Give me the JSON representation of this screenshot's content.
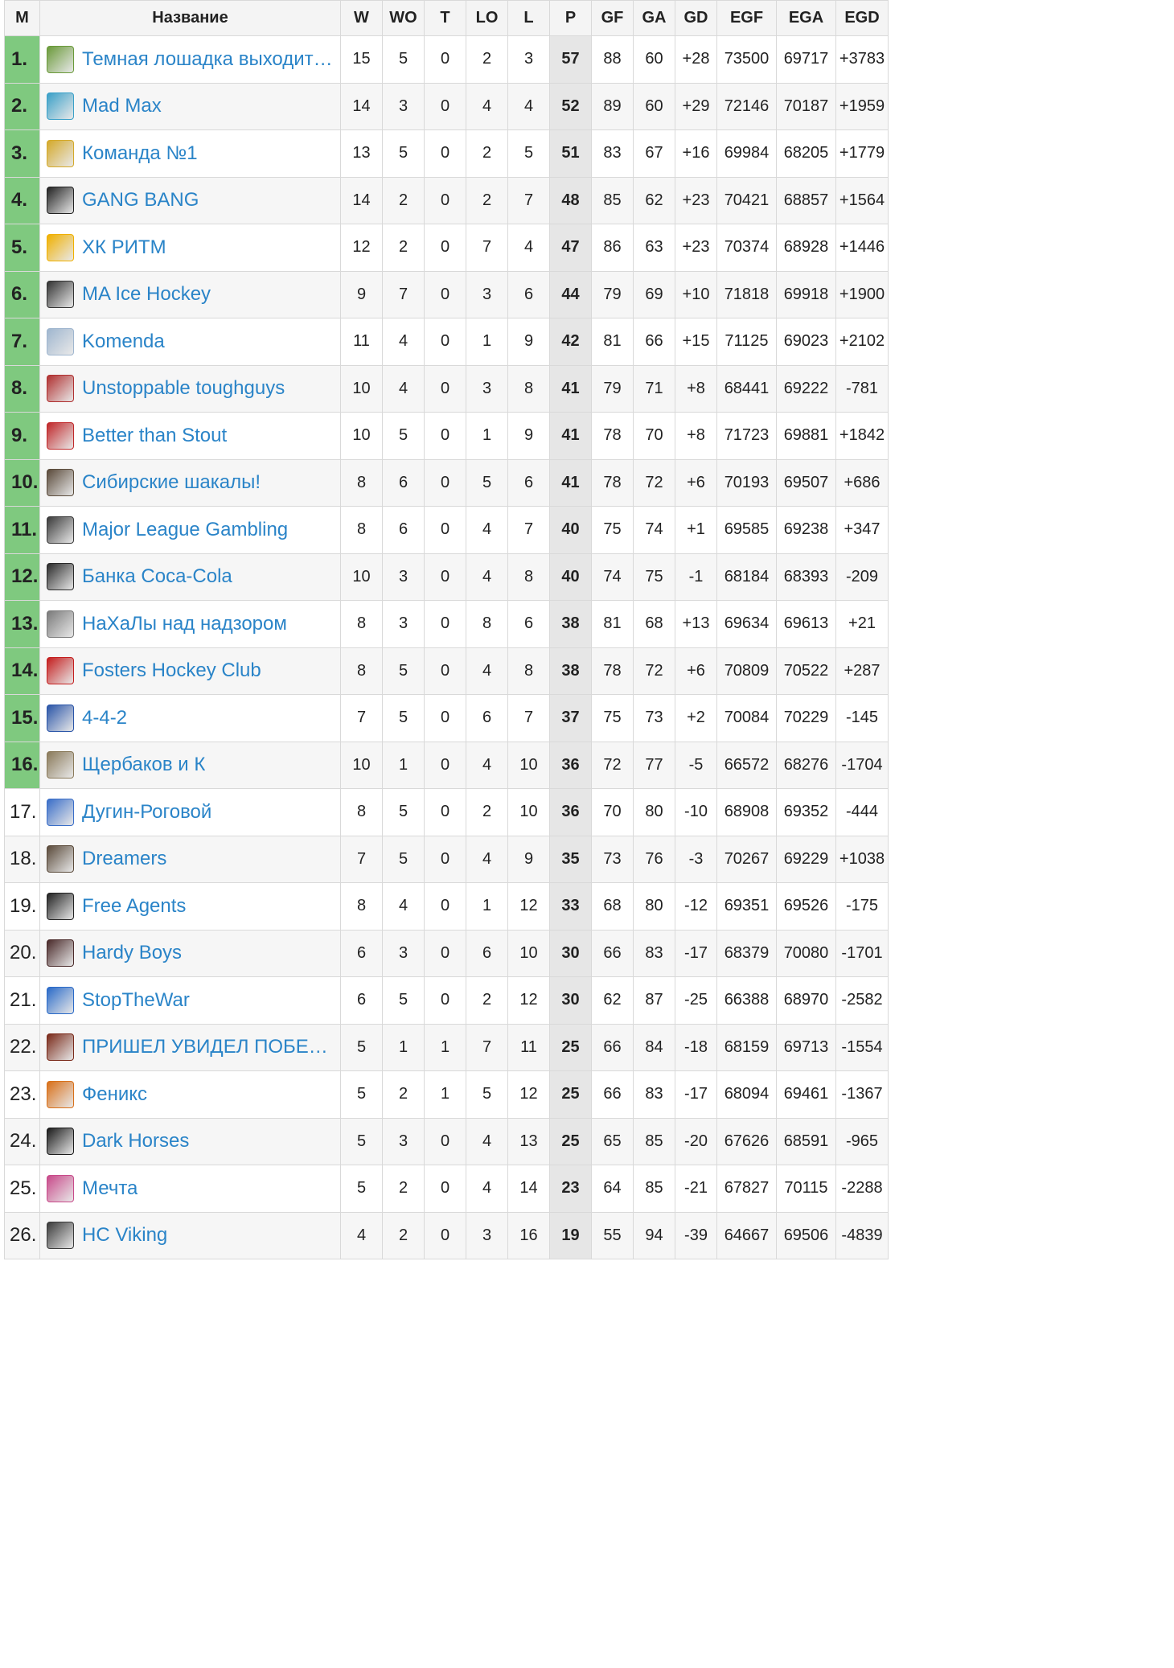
{
  "table": {
    "headers": {
      "rank": "М",
      "name": "Название",
      "w": "W",
      "wo": "WO",
      "t": "T",
      "lo": "LO",
      "l": "L",
      "p": "P",
      "gf": "GF",
      "ga": "GA",
      "gd": "GD",
      "egf": "EGF",
      "ega": "EGA",
      "egd": "EGD"
    },
    "playoff_color": "#7fc97f",
    "link_color": "#2a84c8",
    "positive_color": "#3c9a3c",
    "negative_color": "#d0453e",
    "rows": [
      {
        "rank": "1.",
        "team": "Темная лошадка выходит на поле",
        "logo_icon": "green-horse-shield-icon",
        "logo_color": "#6a9a3a",
        "w": "15",
        "wo": "5",
        "t": "0",
        "lo": "2",
        "l": "3",
        "p": "57",
        "gf": "88",
        "ga": "60",
        "gd": "+28",
        "egf": "73500",
        "ega": "69717",
        "egd": "+3783"
      },
      {
        "rank": "2.",
        "team": "Mad Max",
        "logo_icon": "hockey-player-icon",
        "logo_color": "#3aa0c8",
        "w": "14",
        "wo": "3",
        "t": "0",
        "lo": "4",
        "l": "4",
        "p": "52",
        "gf": "89",
        "ga": "60",
        "gd": "+29",
        "egf": "72146",
        "ega": "70187",
        "egd": "+1959"
      },
      {
        "rank": "3.",
        "team": "Команда №1",
        "logo_icon": "golden-laurel-icon",
        "logo_color": "#d4a92a",
        "w": "13",
        "wo": "5",
        "t": "0",
        "lo": "2",
        "l": "5",
        "p": "51",
        "gf": "83",
        "ga": "67",
        "gd": "+16",
        "egf": "69984",
        "ega": "68205",
        "egd": "+1779"
      },
      {
        "rank": "4.",
        "team": "GANG BANG",
        "logo_icon": "pirate-skull-icon",
        "logo_color": "#222222",
        "w": "14",
        "wo": "2",
        "t": "0",
        "lo": "2",
        "l": "7",
        "p": "48",
        "gf": "85",
        "ga": "62",
        "gd": "+23",
        "egf": "70421",
        "ega": "68857",
        "egd": "+1564"
      },
      {
        "rank": "5.",
        "team": "ХК РИТМ",
        "logo_icon": "star-icon",
        "logo_color": "#f0b000",
        "w": "12",
        "wo": "2",
        "t": "0",
        "lo": "7",
        "l": "4",
        "p": "47",
        "gf": "86",
        "ga": "63",
        "gd": "+23",
        "egf": "70374",
        "ega": "68928",
        "egd": "+1446"
      },
      {
        "rank": "6.",
        "team": "MA Ice Hockey",
        "logo_icon": "ma-circle-icon",
        "logo_color": "#333333",
        "w": "9",
        "wo": "7",
        "t": "0",
        "lo": "3",
        "l": "6",
        "p": "44",
        "gf": "79",
        "ga": "69",
        "gd": "+10",
        "egf": "71818",
        "ega": "69918",
        "egd": "+1900"
      },
      {
        "rank": "7.",
        "team": "Komenda",
        "logo_icon": "ko-badge-icon",
        "logo_color": "#9fb6cf",
        "w": "11",
        "wo": "4",
        "t": "0",
        "lo": "1",
        "l": "9",
        "p": "42",
        "gf": "81",
        "ga": "66",
        "gd": "+15",
        "egf": "71125",
        "ega": "69023",
        "egd": "+2102"
      },
      {
        "rank": "8.",
        "team": "Unstoppable toughguys",
        "logo_icon": "dragon-icon",
        "logo_color": "#b03030",
        "w": "10",
        "wo": "4",
        "t": "0",
        "lo": "3",
        "l": "8",
        "p": "41",
        "gf": "79",
        "ga": "71",
        "gd": "+8",
        "egf": "68441",
        "ega": "69222",
        "egd": "-781"
      },
      {
        "rank": "9.",
        "team": "Better than Stout",
        "logo_icon": "bts-text-icon",
        "logo_color": "#c0282a",
        "w": "10",
        "wo": "5",
        "t": "0",
        "lo": "1",
        "l": "9",
        "p": "41",
        "gf": "78",
        "ga": "70",
        "gd": "+8",
        "egf": "71723",
        "ega": "69881",
        "egd": "+1842"
      },
      {
        "rank": "10.",
        "team": "Сибирские шакалы!",
        "logo_icon": "photo-thumbnail-icon",
        "logo_color": "#5a4a3a",
        "w": "8",
        "wo": "6",
        "t": "0",
        "lo": "5",
        "l": "6",
        "p": "41",
        "gf": "78",
        "ga": "72",
        "gd": "+6",
        "egf": "70193",
        "ega": "69507",
        "egd": "+686"
      },
      {
        "rank": "11.",
        "team": "Major League Gambling",
        "logo_icon": "photo-thumbnail-icon",
        "logo_color": "#3a3a3a",
        "w": "8",
        "wo": "6",
        "t": "0",
        "lo": "4",
        "l": "7",
        "p": "40",
        "gf": "75",
        "ga": "74",
        "gd": "+1",
        "egf": "69585",
        "ega": "69238",
        "egd": "+347"
      },
      {
        "rank": "12.",
        "team": "Банка Coca-Cola",
        "logo_icon": "can-icon",
        "logo_color": "#2a2a2a",
        "w": "10",
        "wo": "3",
        "t": "0",
        "lo": "4",
        "l": "8",
        "p": "40",
        "gf": "74",
        "ga": "75",
        "gd": "-1",
        "egf": "68184",
        "ega": "68393",
        "egd": "-209"
      },
      {
        "rank": "13.",
        "team": "НаХаЛы над надзором",
        "logo_icon": "wolf-icon",
        "logo_color": "#7a7a7a",
        "w": "8",
        "wo": "3",
        "t": "0",
        "lo": "8",
        "l": "6",
        "p": "38",
        "gf": "81",
        "ga": "68",
        "gd": "+13",
        "egf": "69634",
        "ega": "69613",
        "egd": "+21"
      },
      {
        "rank": "14.",
        "team": "Fosters Hockey Club",
        "logo_icon": "red-shield-icon",
        "logo_color": "#c41e1e",
        "w": "8",
        "wo": "5",
        "t": "0",
        "lo": "4",
        "l": "8",
        "p": "38",
        "gf": "78",
        "ga": "72",
        "gd": "+6",
        "egf": "70809",
        "ega": "70522",
        "egd": "+287"
      },
      {
        "rank": "15.",
        "team": "4-4-2",
        "logo_icon": "blue-shield-icon",
        "logo_color": "#2a55a8",
        "w": "7",
        "wo": "5",
        "t": "0",
        "lo": "6",
        "l": "7",
        "p": "37",
        "gf": "75",
        "ga": "73",
        "gd": "+2",
        "egf": "70084",
        "ega": "70229",
        "egd": "-145"
      },
      {
        "rank": "16.",
        "team": "Щербаков и К",
        "logo_icon": "photo-thumbnail-icon",
        "logo_color": "#8a7a5a",
        "w": "10",
        "wo": "1",
        "t": "0",
        "lo": "4",
        "l": "10",
        "p": "36",
        "gf": "72",
        "ga": "77",
        "gd": "-5",
        "egf": "66572",
        "ega": "68276",
        "egd": "-1704"
      },
      {
        "rank": "17.",
        "team": "Дугин-Роговой",
        "logo_icon": "person-photo-icon",
        "logo_color": "#3a6ec8",
        "w": "8",
        "wo": "5",
        "t": "0",
        "lo": "2",
        "l": "10",
        "p": "36",
        "gf": "70",
        "ga": "80",
        "gd": "-10",
        "egf": "68908",
        "ega": "69352",
        "egd": "-444"
      },
      {
        "rank": "18.",
        "team": "Dreamers",
        "logo_icon": "photo-thumbnail-icon",
        "logo_color": "#5a4a3a",
        "w": "7",
        "wo": "5",
        "t": "0",
        "lo": "4",
        "l": "9",
        "p": "35",
        "gf": "73",
        "ga": "76",
        "gd": "-3",
        "egf": "70267",
        "ega": "69229",
        "egd": "+1038"
      },
      {
        "rank": "19.",
        "team": "Free Agents",
        "logo_icon": "free-agents-text-icon",
        "logo_color": "#222222",
        "w": "8",
        "wo": "4",
        "t": "0",
        "lo": "1",
        "l": "12",
        "p": "33",
        "gf": "68",
        "ga": "80",
        "gd": "-12",
        "egf": "69351",
        "ega": "69526",
        "egd": "-175"
      },
      {
        "rank": "20.",
        "team": "Hardy Boys",
        "logo_icon": "photo-thumbnail-icon",
        "logo_color": "#4a2a2a",
        "w": "6",
        "wo": "3",
        "t": "0",
        "lo": "6",
        "l": "10",
        "p": "30",
        "gf": "66",
        "ga": "83",
        "gd": "-17",
        "egf": "68379",
        "ega": "70080",
        "egd": "-1701"
      },
      {
        "rank": "21.",
        "team": "StopTheWar",
        "logo_icon": "stop-war-text-icon",
        "logo_color": "#2a6ac8",
        "w": "6",
        "wo": "5",
        "t": "0",
        "lo": "2",
        "l": "12",
        "p": "30",
        "gf": "62",
        "ga": "87",
        "gd": "-25",
        "egf": "66388",
        "ega": "68970",
        "egd": "-2582"
      },
      {
        "rank": "22.",
        "team": "ПРИШЕЛ УВИДЕЛ ПОБЕДИЛ",
        "logo_icon": "photo-thumbnail-icon",
        "logo_color": "#7a2a1a",
        "w": "5",
        "wo": "1",
        "t": "1",
        "lo": "7",
        "l": "11",
        "p": "25",
        "gf": "66",
        "ga": "84",
        "gd": "-18",
        "egf": "68159",
        "ega": "69713",
        "egd": "-1554"
      },
      {
        "rank": "23.",
        "team": "Феникс",
        "logo_icon": "phoenix-icon",
        "logo_color": "#d8701a",
        "w": "5",
        "wo": "2",
        "t": "1",
        "lo": "5",
        "l": "12",
        "p": "25",
        "gf": "66",
        "ga": "83",
        "gd": "-17",
        "egf": "68094",
        "ega": "69461",
        "egd": "-1367"
      },
      {
        "rank": "24.",
        "team": "Dark Horses",
        "logo_icon": "black-horse-icon",
        "logo_color": "#1a1a1a",
        "w": "5",
        "wo": "3",
        "t": "0",
        "lo": "4",
        "l": "13",
        "p": "25",
        "gf": "65",
        "ga": "85",
        "gd": "-20",
        "egf": "67626",
        "ega": "68591",
        "egd": "-965"
      },
      {
        "rank": "25.",
        "team": "Мечта",
        "logo_icon": "colorful-ring-icon",
        "logo_color": "#c84a8a",
        "w": "5",
        "wo": "2",
        "t": "0",
        "lo": "4",
        "l": "14",
        "p": "23",
        "gf": "64",
        "ga": "85",
        "gd": "-21",
        "egf": "67827",
        "ega": "70115",
        "egd": "-2288"
      },
      {
        "rank": "26.",
        "team": "HC Viking",
        "logo_icon": "viking-crest-icon",
        "logo_color": "#3a3a3a",
        "w": "4",
        "wo": "2",
        "t": "0",
        "lo": "3",
        "l": "16",
        "p": "19",
        "gf": "55",
        "ga": "94",
        "gd": "-39",
        "egf": "64667",
        "ega": "69506",
        "egd": "-4839"
      }
    ]
  }
}
